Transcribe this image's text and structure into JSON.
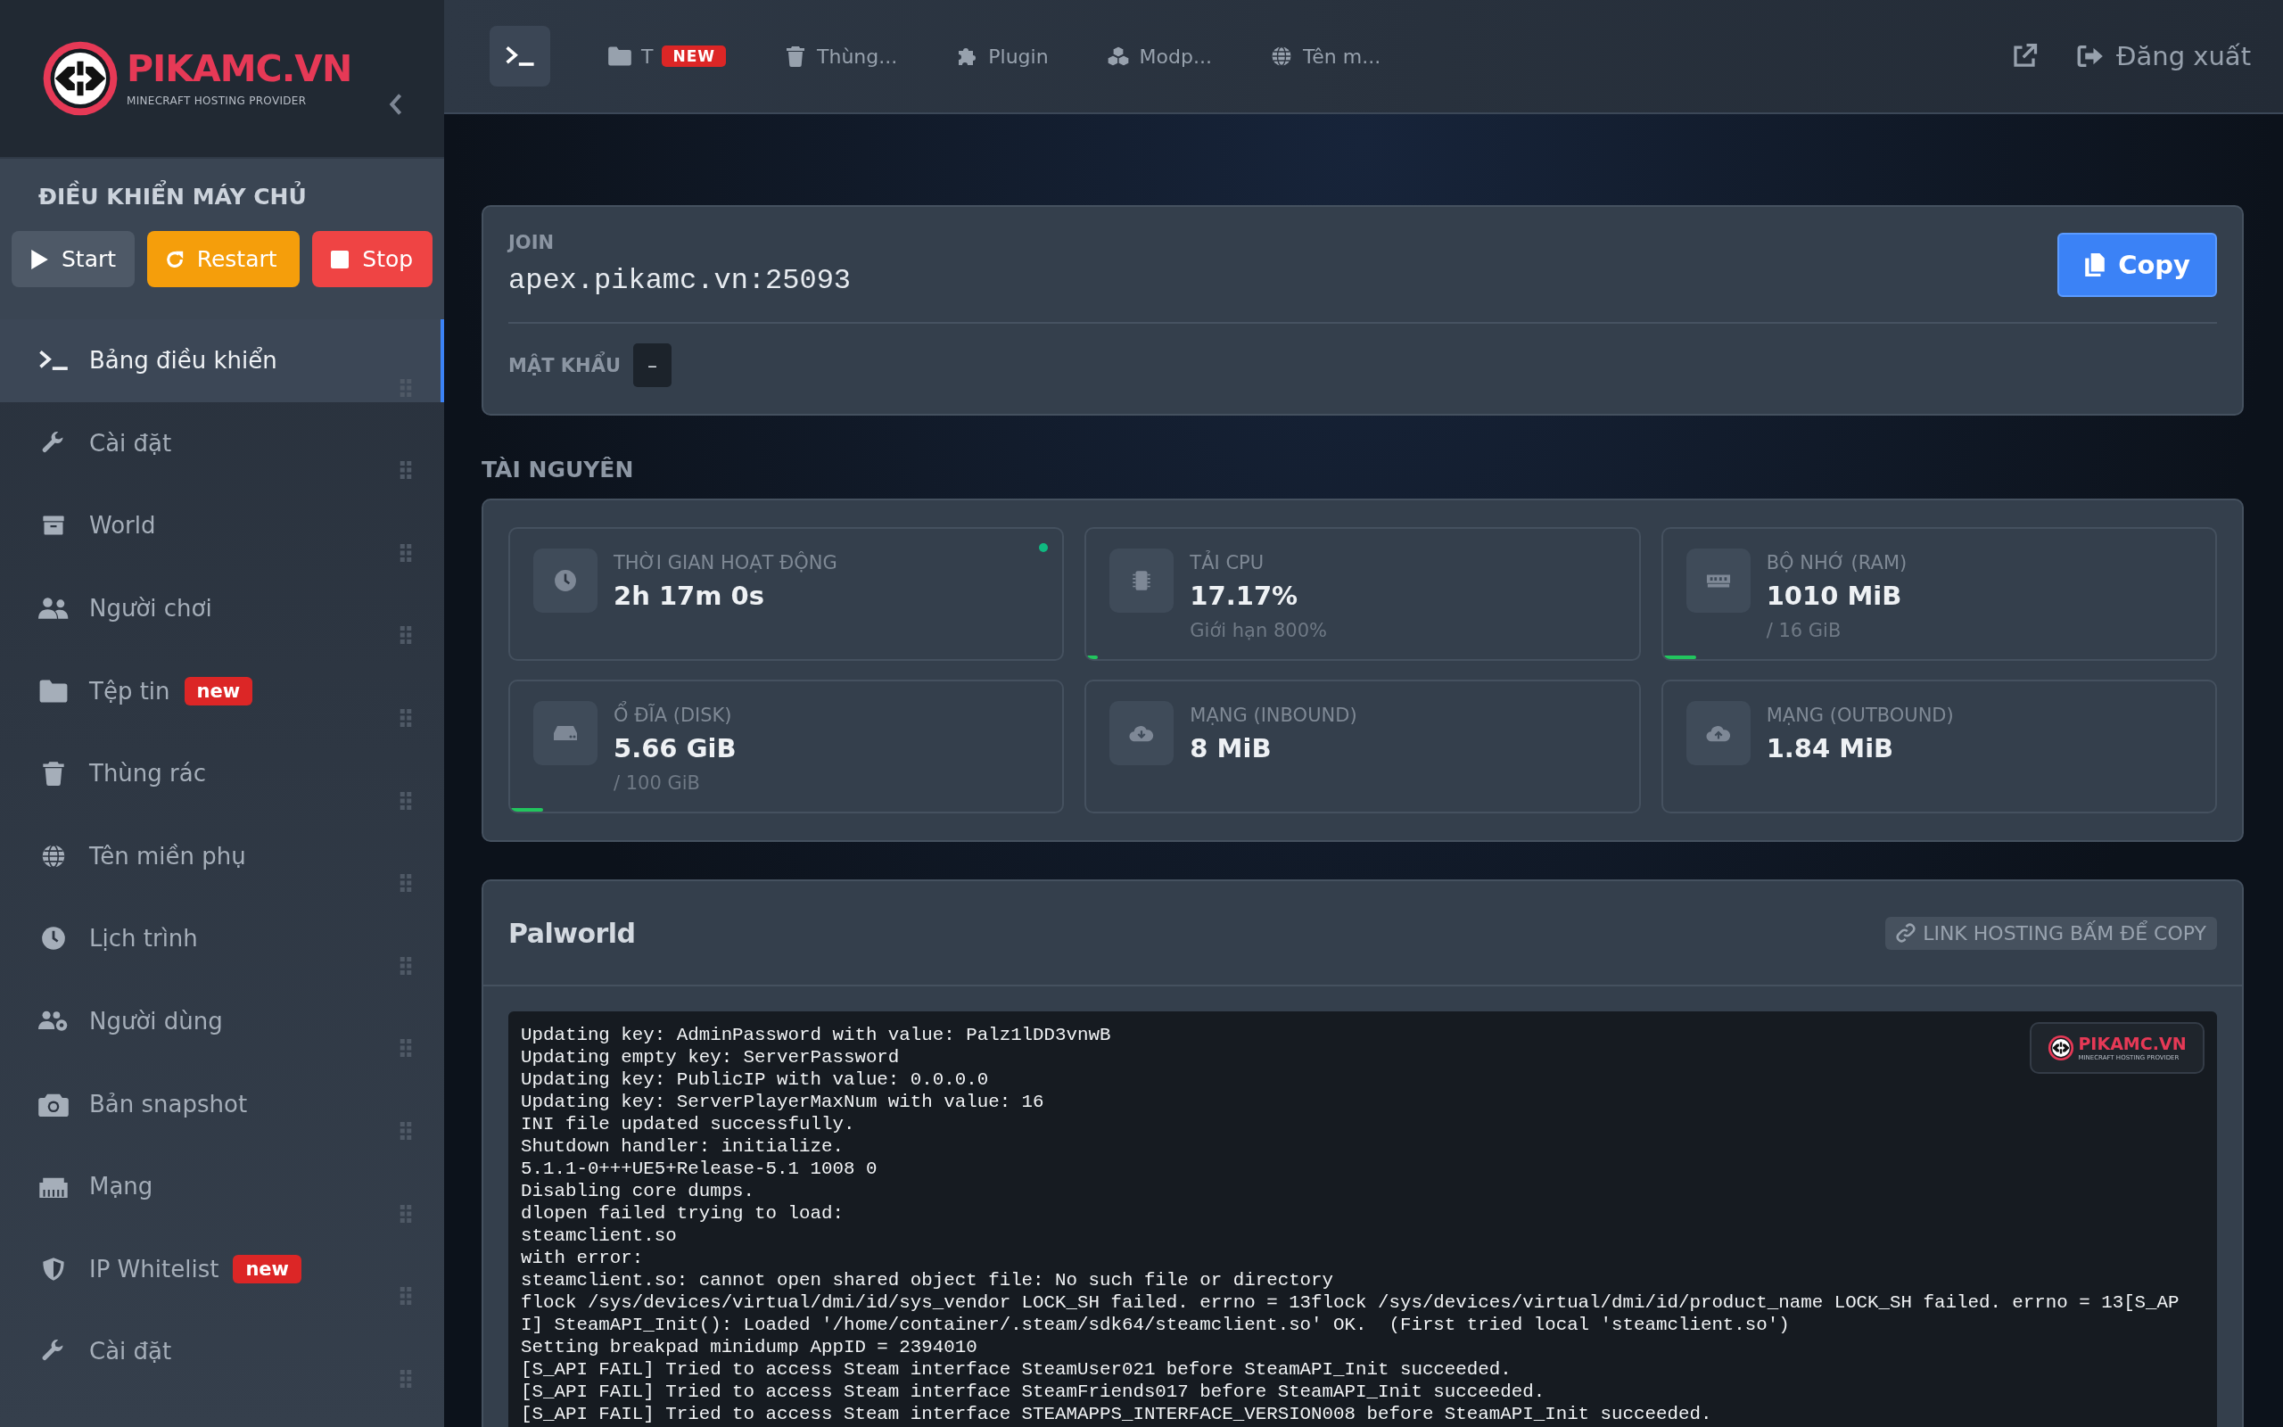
{
  "sidebar": {
    "logo": {
      "name": "PIKAMC.VN",
      "tagline": "MINECRAFT HOSTING PROVIDER"
    },
    "controls": {
      "title": "ĐIỀU KHIỂN MÁY CHỦ",
      "buttons": [
        {
          "label": "Start",
          "kind": "start"
        },
        {
          "label": "Restart",
          "kind": "restart"
        },
        {
          "label": "Stop",
          "kind": "stop"
        }
      ]
    },
    "items": [
      {
        "label": "Bảng điều khiển",
        "selected": true
      },
      {
        "label": "Cài đặt",
        "selected": false
      },
      {
        "label": "World",
        "selected": false
      },
      {
        "label": "Người chơi",
        "selected": false
      },
      {
        "label": "Tệp tin",
        "badge": "new",
        "selected": false
      },
      {
        "label": "Thùng rác",
        "selected": false
      },
      {
        "label": "Tên miền phụ",
        "selected": false
      },
      {
        "label": "Lịch trình",
        "selected": false
      },
      {
        "label": "Người dùng",
        "selected": false
      },
      {
        "label": "Bản snapshot",
        "selected": false
      },
      {
        "label": "Mạng",
        "selected": false
      },
      {
        "label": "IP Whitelist",
        "badge": "new",
        "selected": false
      },
      {
        "label": "Cài đặt",
        "selected": false
      }
    ]
  },
  "toolbar": {
    "tabs": [
      {
        "selected": true
      },
      {
        "label": "T",
        "badge": "NEW",
        "selected": false
      },
      {
        "label": "Thùng...",
        "selected": false
      },
      {
        "label": "Plugin",
        "selected": false
      },
      {
        "label": "Modp...",
        "selected": false
      },
      {
        "label": "Tên m...",
        "selected": false
      }
    ],
    "logout": "Đăng xuất"
  },
  "join": {
    "label": "JOIN",
    "address": "apex.pikamc.vn:25093",
    "copy": "Copy",
    "password_label": "MẬT KHẨU",
    "password": "–"
  },
  "resources": {
    "title": "TÀI NGUYÊN",
    "cards": [
      {
        "label": "THỜI GIAN HOẠT ĐỘNG",
        "value": "2h 17m 0s",
        "online": true
      },
      {
        "label": "TẢI CPU",
        "value": "17.17%",
        "sub": "Giới hạn 800%",
        "level": 0.02,
        "online": false
      },
      {
        "label": "BỘ NHỚ (RAM)",
        "value": "1010 MiB",
        "sub": "/ 16 GiB",
        "level": 0.06,
        "online": false
      },
      {
        "label": "Ổ ĐĨA (DISK)",
        "value": "5.66 GiB",
        "sub": "/ 100 GiB",
        "level": 0.06,
        "online": false
      },
      {
        "label": "MẠNG (INBOUND)",
        "value": "8 MiB",
        "online": false
      },
      {
        "label": "MẠNG (OUTBOUND)",
        "value": "1.84 MiB",
        "online": false
      }
    ]
  },
  "console": {
    "title": "Palworld",
    "link_button": "LINK HOSTING BẤM ĐỂ COPY",
    "logo": {
      "name": "PIKAMC.VN",
      "tagline": "MINECRAFT HOSTING PROVIDER"
    },
    "lines": [
      "Updating key: AdminPassword with value: Palz1lDD3vnwB",
      "Updating empty key: ServerPassword",
      "Updating key: PublicIP with value: 0.0.0.0",
      "Updating key: ServerPlayerMaxNum with value: 16",
      "INI file updated successfully.",
      "Shutdown handler: initialize.",
      "5.1.1-0+++UE5+Release-5.1 1008 0",
      "Disabling core dumps.",
      "dlopen failed trying to load:",
      "steamclient.so",
      "with error:",
      "steamclient.so: cannot open shared object file: No such file or directory",
      "flock /sys/devices/virtual/dmi/id/sys_vendor LOCK_SH failed. errno = 13flock /sys/devices/virtual/dmi/id/product_name LOCK_SH failed. errno = 13[S_AP",
      "I] SteamAPI_Init(): Loaded '/home/container/.steam/sdk64/steamclient.so' OK.  (First tried local 'steamclient.so')",
      "Setting breakpad minidump AppID = 2394010",
      "[S_API FAIL] Tried to access Steam interface SteamUser021 before SteamAPI_Init succeeded.",
      "[S_API FAIL] Tried to access Steam interface SteamFriends017 before SteamAPI_Init succeeded.",
      "[S_API FAIL] Tried to access Steam interface STEAMAPPS_INTERFACE_VERSION008 before SteamAPI_Init succeeded."
    ]
  }
}
